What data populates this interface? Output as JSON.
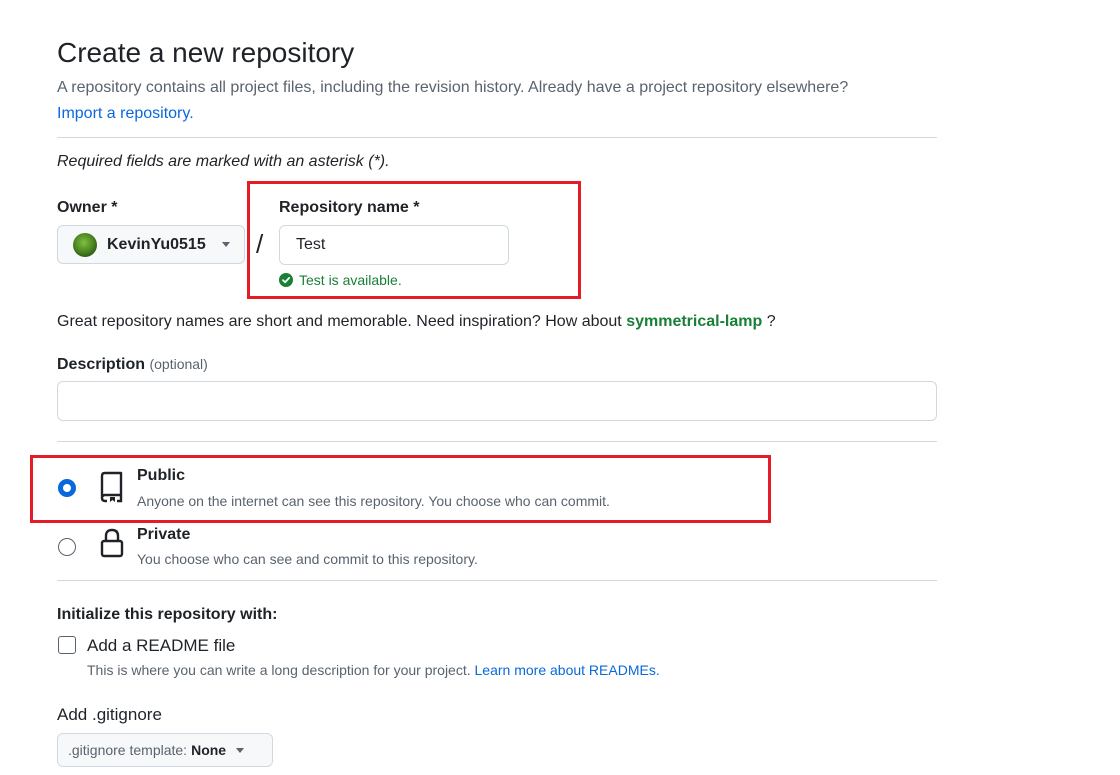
{
  "header": {
    "title": "Create a new repository",
    "subtitle": "A repository contains all project files, including the revision history. Already have a project repository elsewhere?",
    "import_link": "Import a repository."
  },
  "form": {
    "required_note": "Required fields are marked with an asterisk (*).",
    "owner": {
      "label": "Owner *",
      "value": "KevinYu0515"
    },
    "separator": "/",
    "repo_name": {
      "label": "Repository name *",
      "value": "Test",
      "availability": "Test is available."
    },
    "name_hint": {
      "text": "Great repository names are short and memorable. Need inspiration? How about",
      "suggestion": "symmetrical-lamp",
      "suffix": "?"
    },
    "description": {
      "label": "Description",
      "optional": "(optional)",
      "value": ""
    },
    "visibility": {
      "selected": "public",
      "options": [
        {
          "id": "public",
          "title": "Public",
          "description": "Anyone on the internet can see this repository. You choose who can commit.",
          "icon": "repo-icon"
        },
        {
          "id": "private",
          "title": "Private",
          "description": "You choose who can see and commit to this repository.",
          "icon": "lock-icon"
        }
      ]
    },
    "initialize": {
      "heading": "Initialize this repository with:",
      "readme": {
        "label": "Add a README file",
        "checked": false,
        "description": "This is where you can write a long description for your project.",
        "link": "Learn more about READMEs."
      }
    },
    "gitignore": {
      "heading": "Add .gitignore",
      "button_label": ".gitignore template:",
      "button_value": "None"
    }
  },
  "colors": {
    "accent": "#0969da",
    "success": "#1a7f37",
    "highlight": "#e31c25"
  }
}
